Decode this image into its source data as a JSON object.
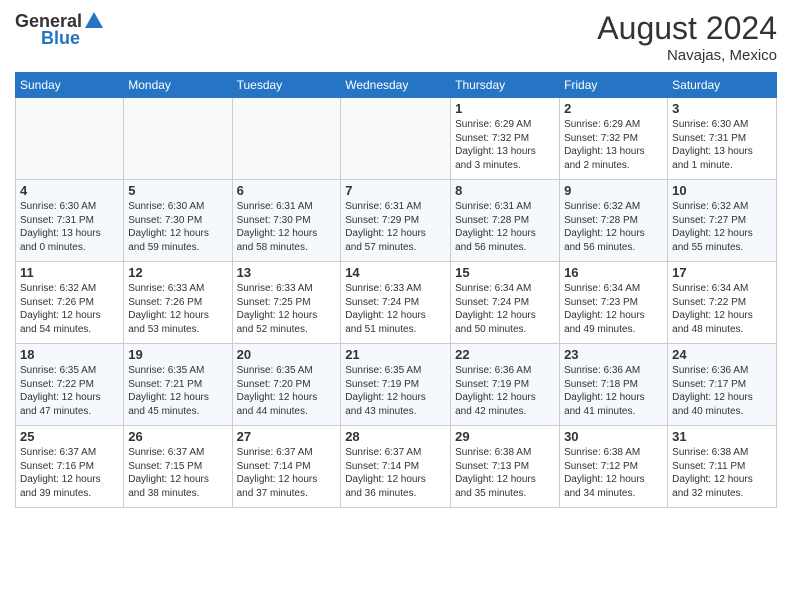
{
  "header": {
    "logo_general": "General",
    "logo_blue": "Blue",
    "month_year": "August 2024",
    "location": "Navajas, Mexico"
  },
  "calendar": {
    "days_of_week": [
      "Sunday",
      "Monday",
      "Tuesday",
      "Wednesday",
      "Thursday",
      "Friday",
      "Saturday"
    ],
    "weeks": [
      [
        {
          "day": "",
          "info": ""
        },
        {
          "day": "",
          "info": ""
        },
        {
          "day": "",
          "info": ""
        },
        {
          "day": "",
          "info": ""
        },
        {
          "day": "1",
          "info": "Sunrise: 6:29 AM\nSunset: 7:32 PM\nDaylight: 13 hours\nand 3 minutes."
        },
        {
          "day": "2",
          "info": "Sunrise: 6:29 AM\nSunset: 7:32 PM\nDaylight: 13 hours\nand 2 minutes."
        },
        {
          "day": "3",
          "info": "Sunrise: 6:30 AM\nSunset: 7:31 PM\nDaylight: 13 hours\nand 1 minute."
        }
      ],
      [
        {
          "day": "4",
          "info": "Sunrise: 6:30 AM\nSunset: 7:31 PM\nDaylight: 13 hours\nand 0 minutes."
        },
        {
          "day": "5",
          "info": "Sunrise: 6:30 AM\nSunset: 7:30 PM\nDaylight: 12 hours\nand 59 minutes."
        },
        {
          "day": "6",
          "info": "Sunrise: 6:31 AM\nSunset: 7:30 PM\nDaylight: 12 hours\nand 58 minutes."
        },
        {
          "day": "7",
          "info": "Sunrise: 6:31 AM\nSunset: 7:29 PM\nDaylight: 12 hours\nand 57 minutes."
        },
        {
          "day": "8",
          "info": "Sunrise: 6:31 AM\nSunset: 7:28 PM\nDaylight: 12 hours\nand 56 minutes."
        },
        {
          "day": "9",
          "info": "Sunrise: 6:32 AM\nSunset: 7:28 PM\nDaylight: 12 hours\nand 56 minutes."
        },
        {
          "day": "10",
          "info": "Sunrise: 6:32 AM\nSunset: 7:27 PM\nDaylight: 12 hours\nand 55 minutes."
        }
      ],
      [
        {
          "day": "11",
          "info": "Sunrise: 6:32 AM\nSunset: 7:26 PM\nDaylight: 12 hours\nand 54 minutes."
        },
        {
          "day": "12",
          "info": "Sunrise: 6:33 AM\nSunset: 7:26 PM\nDaylight: 12 hours\nand 53 minutes."
        },
        {
          "day": "13",
          "info": "Sunrise: 6:33 AM\nSunset: 7:25 PM\nDaylight: 12 hours\nand 52 minutes."
        },
        {
          "day": "14",
          "info": "Sunrise: 6:33 AM\nSunset: 7:24 PM\nDaylight: 12 hours\nand 51 minutes."
        },
        {
          "day": "15",
          "info": "Sunrise: 6:34 AM\nSunset: 7:24 PM\nDaylight: 12 hours\nand 50 minutes."
        },
        {
          "day": "16",
          "info": "Sunrise: 6:34 AM\nSunset: 7:23 PM\nDaylight: 12 hours\nand 49 minutes."
        },
        {
          "day": "17",
          "info": "Sunrise: 6:34 AM\nSunset: 7:22 PM\nDaylight: 12 hours\nand 48 minutes."
        }
      ],
      [
        {
          "day": "18",
          "info": "Sunrise: 6:35 AM\nSunset: 7:22 PM\nDaylight: 12 hours\nand 47 minutes."
        },
        {
          "day": "19",
          "info": "Sunrise: 6:35 AM\nSunset: 7:21 PM\nDaylight: 12 hours\nand 45 minutes."
        },
        {
          "day": "20",
          "info": "Sunrise: 6:35 AM\nSunset: 7:20 PM\nDaylight: 12 hours\nand 44 minutes."
        },
        {
          "day": "21",
          "info": "Sunrise: 6:35 AM\nSunset: 7:19 PM\nDaylight: 12 hours\nand 43 minutes."
        },
        {
          "day": "22",
          "info": "Sunrise: 6:36 AM\nSunset: 7:19 PM\nDaylight: 12 hours\nand 42 minutes."
        },
        {
          "day": "23",
          "info": "Sunrise: 6:36 AM\nSunset: 7:18 PM\nDaylight: 12 hours\nand 41 minutes."
        },
        {
          "day": "24",
          "info": "Sunrise: 6:36 AM\nSunset: 7:17 PM\nDaylight: 12 hours\nand 40 minutes."
        }
      ],
      [
        {
          "day": "25",
          "info": "Sunrise: 6:37 AM\nSunset: 7:16 PM\nDaylight: 12 hours\nand 39 minutes."
        },
        {
          "day": "26",
          "info": "Sunrise: 6:37 AM\nSunset: 7:15 PM\nDaylight: 12 hours\nand 38 minutes."
        },
        {
          "day": "27",
          "info": "Sunrise: 6:37 AM\nSunset: 7:14 PM\nDaylight: 12 hours\nand 37 minutes."
        },
        {
          "day": "28",
          "info": "Sunrise: 6:37 AM\nSunset: 7:14 PM\nDaylight: 12 hours\nand 36 minutes."
        },
        {
          "day": "29",
          "info": "Sunrise: 6:38 AM\nSunset: 7:13 PM\nDaylight: 12 hours\nand 35 minutes."
        },
        {
          "day": "30",
          "info": "Sunrise: 6:38 AM\nSunset: 7:12 PM\nDaylight: 12 hours\nand 34 minutes."
        },
        {
          "day": "31",
          "info": "Sunrise: 6:38 AM\nSunset: 7:11 PM\nDaylight: 12 hours\nand 32 minutes."
        }
      ]
    ]
  }
}
